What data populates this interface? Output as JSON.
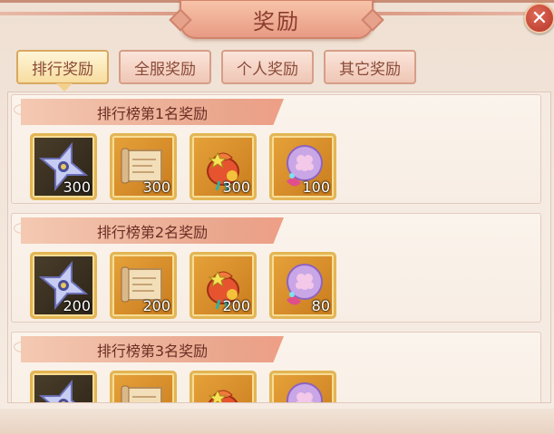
{
  "title": "奖励",
  "close_label": "✕",
  "tabs": [
    {
      "label": "排行奖励",
      "active": true
    },
    {
      "label": "全服奖励",
      "active": false
    },
    {
      "label": "个人奖励",
      "active": false
    },
    {
      "label": "其它奖励",
      "active": false
    }
  ],
  "rows": [
    {
      "title": "排行榜第1名奖励",
      "items": [
        {
          "icon": "shuriken-icon",
          "count": "300"
        },
        {
          "icon": "scroll-icon",
          "count": "300"
        },
        {
          "icon": "pouch-icon",
          "count": "300"
        },
        {
          "icon": "flower-orb-icon",
          "count": "100"
        }
      ]
    },
    {
      "title": "排行榜第2名奖励",
      "items": [
        {
          "icon": "shuriken-icon",
          "count": "200"
        },
        {
          "icon": "scroll-icon",
          "count": "200"
        },
        {
          "icon": "pouch-icon",
          "count": "200"
        },
        {
          "icon": "flower-orb-icon",
          "count": "80"
        }
      ]
    },
    {
      "title": "排行榜第3名奖励",
      "items": [
        {
          "icon": "shuriken-icon",
          "count": ""
        },
        {
          "icon": "scroll-icon",
          "count": ""
        },
        {
          "icon": "pouch-icon",
          "count": ""
        },
        {
          "icon": "flower-orb-icon",
          "count": ""
        }
      ]
    }
  ]
}
